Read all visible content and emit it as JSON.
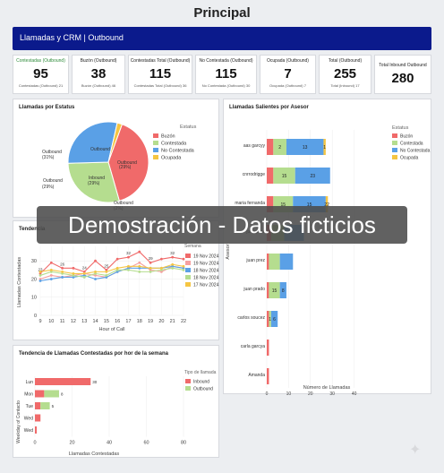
{
  "page_title": "Principal",
  "banner_text": "Llamadas y CRM | Outbound",
  "kpis": [
    {
      "label": "Contestadas (Outbound)",
      "value": "95",
      "sub": "Contestadas (Outbound)  21"
    },
    {
      "label": "Buzón (Outbound)",
      "value": "38",
      "sub": "Buzón (Outbound)  46"
    },
    {
      "label": "Contestadas Total (Outbound)",
      "value": "115",
      "sub": "Contestadas Total (Outbound)  36"
    },
    {
      "label": "No Contestada (Outbound)",
      "value": "115",
      "sub": "No Contestada (Outbound)  30"
    },
    {
      "label": "Ocupada (Outbound)",
      "value": "7",
      "sub": "Ocupada (Outbound)  7"
    },
    {
      "label": "Total (Outbound)",
      "value": "255",
      "sub": "Total (Inbound)  17"
    },
    {
      "label": "Total Inbound Outbound",
      "value": "280",
      "sub": ""
    }
  ],
  "colors": {
    "buzon": "#f06a6a",
    "contestada": "#b5dd8f",
    "no_contestada": "#5aa0e6",
    "ocupada": "#f5c542",
    "banner": "#0b1a8c"
  },
  "pie_panel": {
    "title": "Llamadas por Estatus",
    "legend_title": "Estatus",
    "slice_labels": [
      {
        "name": "Outbound",
        "pct": "(31%)"
      },
      {
        "name": "Outbound",
        "pct": "(29%)"
      },
      {
        "name": "Outbound",
        "pct": "40"
      },
      {
        "name": "Inbound",
        "pct": "20"
      },
      {
        "name": "Outbound",
        "pct": "(29%)"
      },
      {
        "name": "Outbound",
        "pct": "(2%)"
      }
    ]
  },
  "line_panel": {
    "title": "Tendencia",
    "legend_title": "Semana",
    "y_axis_title": "Llamadas Contestadas",
    "x_axis_title": "Hour of Call"
  },
  "hbar_small_panel": {
    "title": "Tendencia de Llamadas Contestadas por hor de la semana",
    "legend_title": "Tipo de llamada",
    "legend": [
      "Inbound",
      "Outbound"
    ],
    "y_axis_title": "Weekday of Contacto",
    "x_axis_title": "Llamadas Contestadas"
  },
  "hbar_big_panel": {
    "title": "Llamadas Salientes por Asesor",
    "legend_title": "Estatus",
    "y_axis_title": "Asesor",
    "x_axis_title": "Número de Llamadas"
  },
  "overlay_text": "Demostración - Datos ficticios",
  "chart_data": [
    {
      "type": "pie",
      "title": "Llamadas por Estatus",
      "categories": [
        "Buzón",
        "Contestada",
        "No Contestada",
        "Ocupada"
      ],
      "values": [
        40,
        29,
        29,
        2
      ]
    },
    {
      "type": "line",
      "title": "Tendencia",
      "x": [
        9,
        10,
        11,
        12,
        13,
        14,
        15,
        16,
        17,
        18,
        19,
        20,
        21,
        22
      ],
      "xlabel": "Hour of Call",
      "ylabel": "Llamadas Contestadas",
      "ylim": [
        0,
        38
      ],
      "yticks": [
        0,
        10,
        20,
        30
      ],
      "series": [
        {
          "name": "19 Nov 2024",
          "values": [
            23,
            29,
            26,
            26,
            24,
            30,
            25,
            31,
            32,
            35,
            29,
            31,
            32,
            31
          ]
        },
        {
          "name": "19 Nov 2024",
          "values": [
            20,
            22,
            21,
            22,
            23,
            22,
            21,
            24,
            26,
            29,
            25,
            24,
            27,
            26
          ]
        },
        {
          "name": "18 Nov 2024",
          "values": [
            19,
            20,
            21,
            21,
            22,
            20,
            21,
            24,
            26,
            26,
            26,
            26,
            27,
            26
          ]
        },
        {
          "name": "18 Nov 2024",
          "values": [
            22,
            24,
            23,
            22,
            21,
            23,
            22,
            25,
            25,
            24,
            24,
            25,
            26,
            25
          ]
        },
        {
          "name": "17 Nov 2024",
          "values": [
            24,
            25,
            24,
            23,
            23,
            24,
            24,
            26,
            27,
            27,
            26,
            26,
            28,
            27
          ]
        }
      ]
    },
    {
      "type": "bar",
      "orientation": "horizontal",
      "title": "Tendencia de Llamadas Contestadas por hor de la semana",
      "categories": [
        "Lun",
        "Mon",
        "Tue",
        "Wed",
        "Wed"
      ],
      "xlabel": "Llamadas Contestadas",
      "ylabel": "Weekday of Contacto",
      "xlim": [
        0,
        80
      ],
      "xticks": [
        0,
        20,
        40,
        60,
        80
      ],
      "series": [
        {
          "name": "Inbound",
          "values": [
            30,
            5,
            3,
            3,
            1
          ]
        },
        {
          "name": "Outbound",
          "values": [
            0,
            8,
            5,
            0,
            0
          ]
        }
      ],
      "data_labels": [
        "30",
        "8",
        "5",
        "",
        ""
      ]
    },
    {
      "type": "bar",
      "orientation": "horizontal",
      "stacked": true,
      "title": "Llamadas Salientes por Asesor",
      "categories": [
        "aas garcyy",
        "cnrrodrigge",
        "maria fernanda",
        "juan prez",
        "juan prez",
        "juan prado",
        "carlos soucez",
        "carla garcya",
        "Amanda"
      ],
      "xlabel": "Número de Llamadas",
      "ylabel": "Asesor",
      "xlim": [
        0,
        50
      ],
      "xticks": [
        0,
        10,
        20,
        30,
        40
      ],
      "series": [
        {
          "name": "Buzón",
          "values": [
            3,
            3,
            3,
            2,
            1,
            1,
            1,
            1,
            1
          ]
        },
        {
          "name": "Contestada",
          "values": [
            6,
            10,
            9,
            6,
            5,
            5,
            1,
            0,
            0
          ]
        },
        {
          "name": "No Contestada",
          "values": [
            17,
            16,
            15,
            9,
            6,
            3,
            3,
            0,
            0
          ]
        },
        {
          "name": "Ocupada",
          "values": [
            1,
            0,
            1,
            0,
            0,
            0,
            0,
            0,
            0
          ]
        }
      ],
      "data_labels": [
        [
          "",
          "2",
          "13",
          "1"
        ],
        [
          "",
          "15",
          "23",
          "8"
        ],
        [
          "",
          "15",
          "15",
          "22"
        ],
        [
          "",
          "",
          "",
          ""
        ],
        [
          "",
          "",
          "",
          ""
        ],
        [
          "",
          "15",
          "8",
          ""
        ],
        [
          "",
          "1",
          "6",
          ""
        ],
        [
          "",
          "",
          "",
          ""
        ],
        [
          "",
          "",
          "",
          ""
        ]
      ]
    }
  ]
}
